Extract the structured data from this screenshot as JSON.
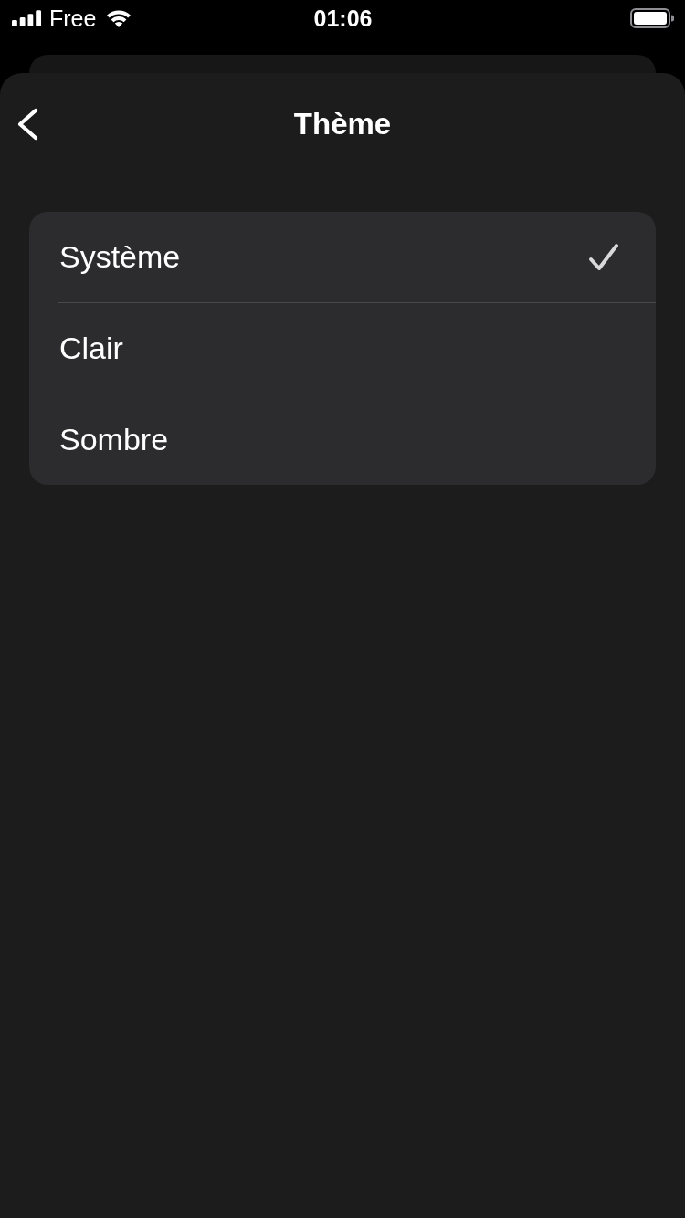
{
  "status_bar": {
    "carrier": "Free",
    "time": "01:06"
  },
  "header": {
    "title": "Thème"
  },
  "options": [
    {
      "label": "Système",
      "selected": true
    },
    {
      "label": "Clair",
      "selected": false
    },
    {
      "label": "Sombre",
      "selected": false
    }
  ]
}
